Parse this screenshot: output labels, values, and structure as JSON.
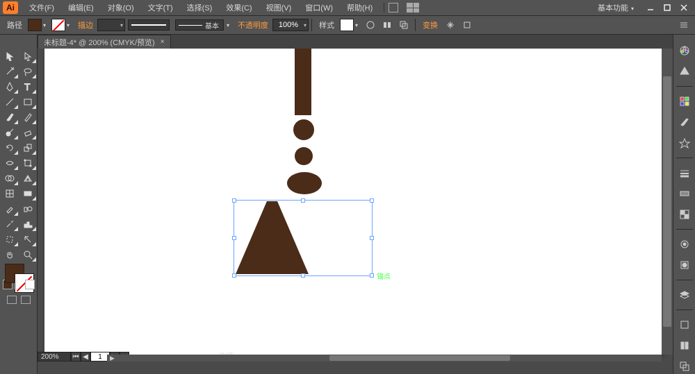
{
  "app": {
    "logo_text": "Ai"
  },
  "menu": {
    "file": "文件(F)",
    "edit": "编辑(E)",
    "object": "对象(O)",
    "type": "文字(T)",
    "select": "选择(S)",
    "effect": "效果(C)",
    "view": "视图(V)",
    "window": "窗口(W)",
    "help": "帮助(H)"
  },
  "workspace": "基本功能",
  "selection_label": "路径",
  "controlbar": {
    "stroke_label": "描边",
    "stroke_pt": "",
    "profile_label": "基本",
    "opacity_label": "不透明度",
    "opacity_value": "100%",
    "style_label": "样式",
    "transform_label": "变换",
    "fill_color": "#4a2c18"
  },
  "tab": {
    "title": "未标题-4* @ 200% (CMYK/预览)",
    "close": "×"
  },
  "status": {
    "zoom": "200%",
    "page_current": "1",
    "mode_label": "选择"
  },
  "anchor_hint": "锚点",
  "tools": [
    "selection",
    "direct-selection",
    "magic-wand",
    "lasso",
    "pen",
    "type",
    "line",
    "rectangle",
    "paintbrush",
    "pencil",
    "blob-brush",
    "eraser",
    "rotate",
    "scale",
    "width",
    "free-transform",
    "shape-builder",
    "perspective",
    "mesh",
    "gradient",
    "eyedropper",
    "blend",
    "symbol-sprayer",
    "column-graph",
    "artboard",
    "slice",
    "hand",
    "zoom"
  ],
  "panels": [
    "color",
    "color-guide",
    "swatches",
    "brushes",
    "symbols",
    "stroke",
    "gradient",
    "transparency",
    "appearance",
    "graphic-styles",
    "layers",
    "transform",
    "align",
    "pathfinder"
  ]
}
